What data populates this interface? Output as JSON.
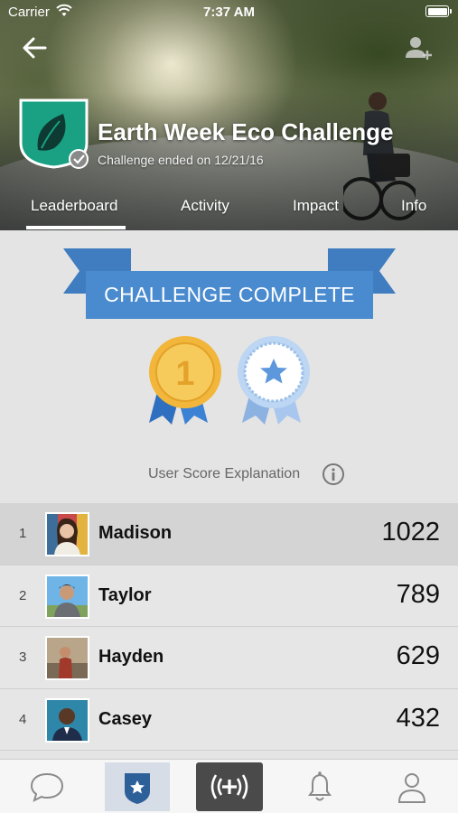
{
  "status_bar": {
    "carrier": "Carrier",
    "time": "7:37 AM"
  },
  "challenge": {
    "title": "Earth Week Eco Challenge",
    "subtitle": "Challenge ended on 12/21/16"
  },
  "tabs": [
    {
      "label": "Leaderboard",
      "active": true
    },
    {
      "label": "Activity",
      "active": false
    },
    {
      "label": "Impact",
      "active": false
    },
    {
      "label": "Info",
      "active": false
    }
  ],
  "banner": {
    "text": "CHALLENGE COMPLETE"
  },
  "medals": [
    {
      "icon": "gold-first-place-medal-icon",
      "label": "1"
    },
    {
      "icon": "blue-star-medal-icon"
    }
  ],
  "score_explanation": {
    "label": "User Score Explanation",
    "icon": "info-icon"
  },
  "leaderboard": [
    {
      "rank": "1",
      "name": "Madison",
      "score": "1022"
    },
    {
      "rank": "2",
      "name": "Taylor",
      "score": "789"
    },
    {
      "rank": "3",
      "name": "Hayden",
      "score": "629"
    },
    {
      "rank": "4",
      "name": "Casey",
      "score": "432"
    }
  ],
  "bottom_nav": [
    {
      "icon": "chat-bubble-icon",
      "active": false
    },
    {
      "icon": "shield-star-icon",
      "active": true
    },
    {
      "icon": "broadcast-plus-icon",
      "active": false
    },
    {
      "icon": "bell-icon",
      "active": false
    },
    {
      "icon": "profile-icon",
      "active": false
    }
  ],
  "colors": {
    "banner_blue": "#3f7dc0",
    "banner_dark": "#2d5f99",
    "badge_green": "#1aa083",
    "gold": "#f2b63a",
    "silver_blue": "#9cc0ea"
  }
}
